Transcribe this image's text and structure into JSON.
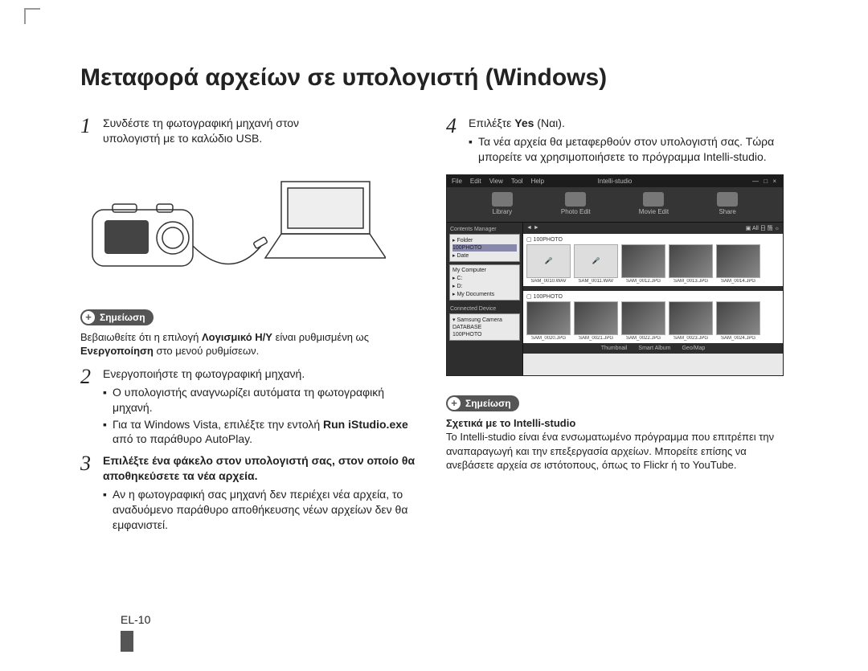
{
  "page": {
    "title": "Μεταφορά αρχείων σε υπολογιστή (Windows)",
    "footer": "EL-10"
  },
  "left": {
    "step1": {
      "num": "1",
      "text_a": "Συνδέστε τη φωτογραφική μηχανή στον",
      "text_b": "υπολογιστή με το καλώδιο USB."
    },
    "note1": {
      "label": "Σημείωση",
      "text_a": "Βεβαιωθείτε ότι η επιλογή ",
      "bold_a": "Λογισμικό Η/Υ",
      "text_b": " είναι ρυθμισμένη ως ",
      "bold_b": "Ενεργοποίηση",
      "text_c": " στο μενού ρυθμίσεων."
    },
    "step2": {
      "num": "2",
      "lead": "Ενεργοποιήστε τη φωτογραφική μηχανή.",
      "b1": "Ο υπολογιστής αναγνωρίζει αυτόματα τη φωτογραφική μηχανή.",
      "b2_a": "Για τα Windows Vista, επιλέξτε την εντολή ",
      "b2_bold": "Run iStudio.exe",
      "b2_b": " από το παράθυρο AutoPlay."
    },
    "step3": {
      "num": "3",
      "lead": "Επιλέξτε ένα φάκελο στον υπολογιστή σας, στον οποίο θα αποθηκεύσετε τα νέα αρχεία.",
      "b1": "Αν η φωτογραφική σας μηχανή δεν περιέχει νέα αρχεία, το αναδυόμενο παράθυρο αποθήκευσης νέων αρχείων δεν θα εμφανιστεί."
    }
  },
  "right": {
    "step4": {
      "num": "4",
      "lead_a": "Επιλέξτε ",
      "lead_bold": "Yes",
      "lead_b": " (Ναι).",
      "b1": "Τα νέα αρχεία θα μεταφερθούν στον υπολογιστή σας. Τώρα μπορείτε να χρησιμοποιήσετε το πρόγραμμα Intelli-studio."
    },
    "note2": {
      "label": "Σημείωση",
      "heading": "Σχετικά με το Intelli-studio",
      "text": "Το Intelli-studio είναι ένα ενσωματωμένο πρόγραμμα που επιτρέπει την αναπαραγωγή και την επεξεργασία αρχείων. Μπορείτε επίσης να ανεβάσετε αρχεία σε ιστότοπους, όπως το Flickr ή το YouTube."
    }
  },
  "screenshot": {
    "menu": {
      "file": "File",
      "edit": "Edit",
      "view": "View",
      "tool": "Tool",
      "help": "Help",
      "title": "Intelli-studio",
      "winbtns": "— □ ×"
    },
    "topicons": {
      "a": "Library",
      "b": "Photo Edit",
      "c": "Movie Edit",
      "d": "Share"
    },
    "toolbar": {
      "left": "◄ ►",
      "right": "▣ All 日 箇 ☼"
    },
    "side": {
      "header": "Contents Manager",
      "box1_a": "▸ Folder",
      "box1_b": "  100PHOTO",
      "box1_c": "▸ Date",
      "box2_a": "My Computer",
      "box2_b": "▸ C:",
      "box2_c": "▸ D:",
      "box2_d": "▸ My Documents",
      "box3_h": "Connected Device",
      "box3_a": "▾ Samsung Camera",
      "box3_b": "  DATABASE",
      "box3_c": "  100PHOTO"
    },
    "seg1_h": "▢ 100PHOTO",
    "seg2_h": "▢ 100PHOTO",
    "caps": {
      "a": "SAM_0010.WAV",
      "b": "SAM_0011.WAV",
      "c": "SAM_0012.JPG",
      "d": "SAM_0013.JPG",
      "e": "SAM_0014.JPG",
      "f": "SAM_0020.JPG",
      "g": "SAM_0021.JPG",
      "h": "SAM_0022.JPG",
      "i": "SAM_0023.JPG",
      "j": "SAM_0024.JPG"
    },
    "bottom": {
      "a": "Thumbnail",
      "b": "Smart Album",
      "c": "Geo/Map"
    }
  }
}
